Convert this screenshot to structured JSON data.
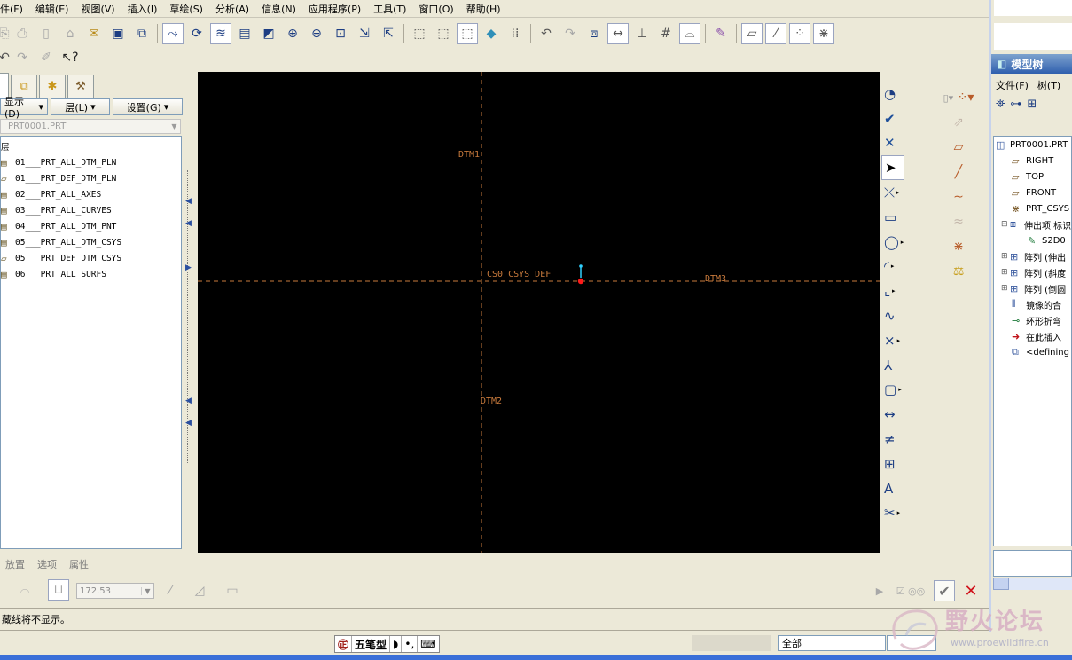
{
  "menu": [
    "文件(F)",
    "编辑(E)",
    "视图(V)",
    "插入(I)",
    "草绘(S)",
    "分析(A)",
    "信息(N)",
    "应用程序(P)",
    "工具(T)",
    "窗口(W)",
    "帮助(H)"
  ],
  "menu_visible": [
    "件(F)",
    "编辑(E)",
    "视图(V)",
    "插入(I)",
    "草绘(S)",
    "分析(A)",
    "信息(N)",
    "应用程序(P)",
    "工具(T)",
    "窗口(O)",
    "帮助(H)"
  ],
  "layer_panel": {
    "dropdowns": [
      "显示(D)",
      "层(L)",
      "设置(G)"
    ],
    "model_combo": "PRT0001.PRT",
    "root": "层",
    "layers": [
      "01___PRT_ALL_DTM_PLN",
      "01___PRT_DEF_DTM_PLN",
      "02___PRT_ALL_AXES",
      "03___PRT_ALL_CURVES",
      "04___PRT_ALL_DTM_PNT",
      "05___PRT_ALL_DTM_CSYS",
      "05___PRT_DEF_DTM_CSYS",
      "06___PRT_ALL_SURFS"
    ]
  },
  "canvas": {
    "labels": {
      "dtm1": "DTM1",
      "dtm2": "DTM2",
      "dtm3": "DTM3",
      "csys": "CS0_CSYS_DEF"
    },
    "line_color": "#c87a3c",
    "marker_color": "#ff1a1a",
    "cursor_color": "#30d0ff"
  },
  "dashboard": {
    "tabs": [
      "放置",
      "选项",
      "属性"
    ],
    "value": "172.53"
  },
  "message": "藏线将不显示。",
  "taskbar": {
    "ime_label": "五笔型",
    "filter": "全部"
  },
  "model_tree": {
    "title": "模型树",
    "menu": [
      "文件(F)",
      "树(T)"
    ],
    "items": [
      {
        "label": "PRT0001.PRT",
        "icon": "part-icon",
        "expander": ""
      },
      {
        "label": "RIGHT",
        "icon": "datum-plane-icon",
        "expander": ""
      },
      {
        "label": "TOP",
        "icon": "datum-plane-icon",
        "expander": ""
      },
      {
        "label": "FRONT",
        "icon": "datum-plane-icon",
        "expander": ""
      },
      {
        "label": "PRT_CSYS",
        "icon": "csys-icon",
        "expander": ""
      },
      {
        "label": "伸出项 标识",
        "icon": "extrude-icon",
        "expander": "⊟"
      },
      {
        "label": "S2D0",
        "icon": "sketch-icon",
        "expander": ""
      },
      {
        "label": "阵列 (伸出",
        "icon": "pattern-icon",
        "expander": "⊞"
      },
      {
        "label": "阵列 (斜度",
        "icon": "pattern-icon",
        "expander": "⊞"
      },
      {
        "label": "阵列 (倒圆",
        "icon": "pattern-icon",
        "expander": "⊞"
      },
      {
        "label": "镜像的合",
        "icon": "mirror-icon",
        "expander": ""
      },
      {
        "label": "环形折弯",
        "icon": "toroidal-bend-icon",
        "expander": ""
      },
      {
        "label": "在此插入",
        "icon": "insert-arrow-icon",
        "expander": ""
      },
      {
        "label": "<defining",
        "icon": "sketch-icon",
        "expander": ""
      }
    ]
  },
  "watermark": {
    "text": "野火论坛",
    "url": "www.proewildfire.cn"
  }
}
